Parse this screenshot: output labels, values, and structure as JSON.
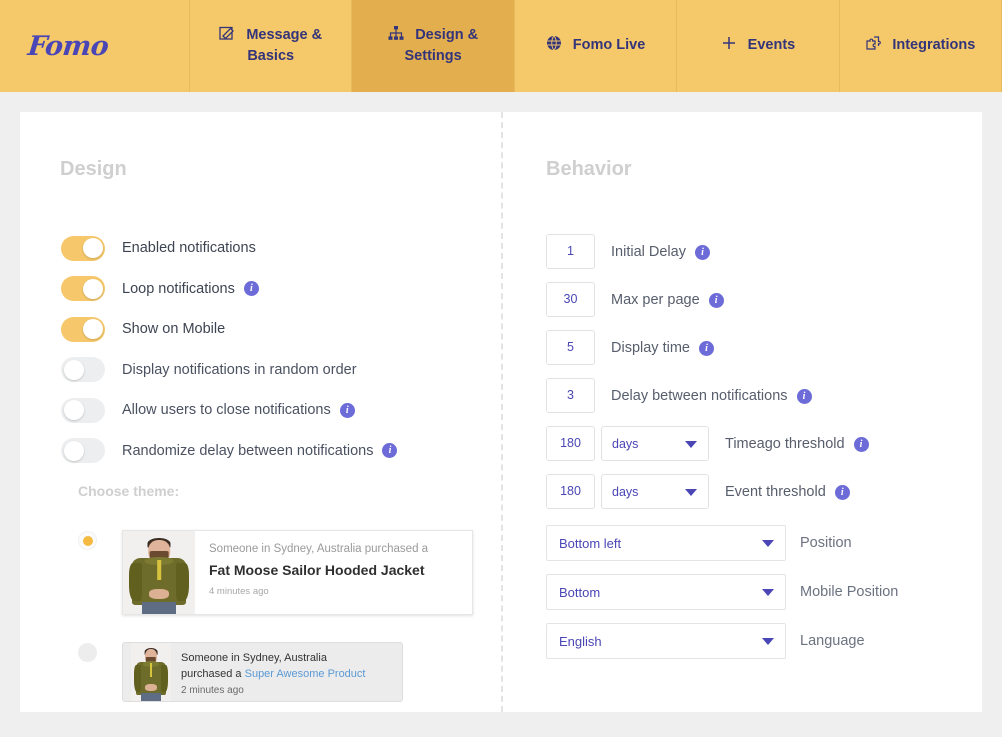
{
  "nav": {
    "brand": "Fomo",
    "tabs": [
      {
        "label": "Message & Basics",
        "icon": "pencil-square-icon",
        "active": false
      },
      {
        "label": "Design & Settings",
        "icon": "sitemap-icon",
        "active": true
      },
      {
        "label": "Fomo Live",
        "icon": "globe-icon",
        "active": false
      },
      {
        "label": "Events",
        "icon": "plus-icon",
        "active": false
      },
      {
        "label": "Integrations",
        "icon": "puzzle-piece-icon",
        "active": false
      }
    ]
  },
  "design": {
    "title": "Design",
    "toggles": [
      {
        "label": "Enabled notifications",
        "on": true,
        "info": false
      },
      {
        "label": "Loop notifications",
        "on": true,
        "info": true
      },
      {
        "label": "Show on Mobile",
        "on": true,
        "info": false
      },
      {
        "label": "Display notifications in random order",
        "on": false,
        "info": false
      },
      {
        "label": "Allow users to close notifications",
        "on": false,
        "info": true
      },
      {
        "label": "Randomize delay between notifications",
        "on": false,
        "info": true
      }
    ],
    "choose_theme_label": "Choose theme:",
    "themes": [
      {
        "selected": true,
        "line1": "Someone in Sydney, Australia purchased a",
        "line2": "Fat Moose Sailor Hooded Jacket",
        "time": "4 minutes ago"
      },
      {
        "selected": false,
        "line1": "Someone in Sydney, Australia",
        "line2_prefix": "purchased a ",
        "line2_link": "Super Awesome Product",
        "time": "2 minutes ago"
      }
    ]
  },
  "behavior": {
    "title": "Behavior",
    "fields": [
      {
        "value": "1",
        "label": "Initial Delay",
        "info": true,
        "unit": null
      },
      {
        "value": "30",
        "label": "Max per page",
        "info": true,
        "unit": null
      },
      {
        "value": "5",
        "label": "Display time",
        "info": true,
        "unit": null
      },
      {
        "value": "3",
        "label": "Delay between notifications",
        "info": true,
        "unit": null
      },
      {
        "value": "180",
        "label": "Timeago threshold",
        "info": true,
        "unit": "days"
      },
      {
        "value": "180",
        "label": "Event threshold",
        "info": true,
        "unit": "days"
      }
    ],
    "selects": [
      {
        "value": "Bottom left",
        "label": "Position"
      },
      {
        "value": "Bottom",
        "label": "Mobile Position"
      },
      {
        "value": "English",
        "label": "Language"
      }
    ]
  },
  "colors": {
    "header_bg": "#f5c869",
    "header_active_bg": "#e3ae4e",
    "brand_purple": "#4a46b5",
    "toggle_on": "#f6c86b",
    "info_badge": "#6c6bd8",
    "page_bg": "#efefef",
    "link_blue": "#5b9ad4"
  }
}
